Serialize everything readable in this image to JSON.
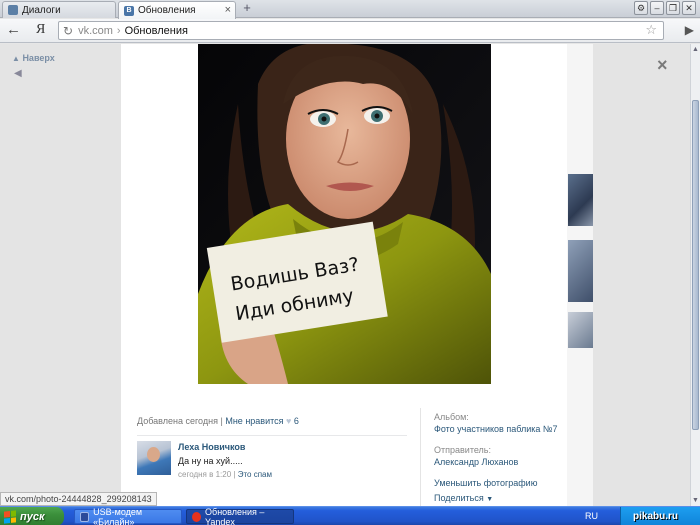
{
  "browser": {
    "tabs": [
      {
        "title": "Диалоги",
        "active": false
      },
      {
        "title": "Обновления",
        "active": true
      }
    ],
    "new_tab": "+",
    "address": {
      "domain": "vk.com",
      "separator": "›",
      "path": "Обновления"
    },
    "yandex_button": "Я"
  },
  "page": {
    "up_link": "Наверх",
    "close_label": "×",
    "photo": {
      "caption_line1": "Водишь Ваз?",
      "caption_line2": "Иди обниму"
    },
    "meta": {
      "added": "Добавлена сегодня",
      "separator": "|",
      "like_label": "Мне нравится",
      "like_count": "6"
    },
    "comment": {
      "author": "Леха Новичков",
      "text": "Да ну на хуй.....",
      "time": "сегодня в 1:20",
      "separator": "|",
      "spam_link": "Это спам"
    },
    "sidebar": {
      "album_label": "Альбом:",
      "album_value": "Фото участников паблика №7",
      "sender_label": "Отправитель:",
      "sender_value": "Александр Люханов",
      "shrink_link": "Уменьшить фотографию",
      "share_link": "Поделиться"
    }
  },
  "status_url": "vk.com/photo-24444828_299208143",
  "taskbar": {
    "start": "пуск",
    "tasks": [
      {
        "title": "USB-модем «Билайн»",
        "active": false
      },
      {
        "title": "Обновления – Yandex",
        "active": true
      }
    ],
    "lang": "RU",
    "watermark": "pikabu.ru"
  }
}
